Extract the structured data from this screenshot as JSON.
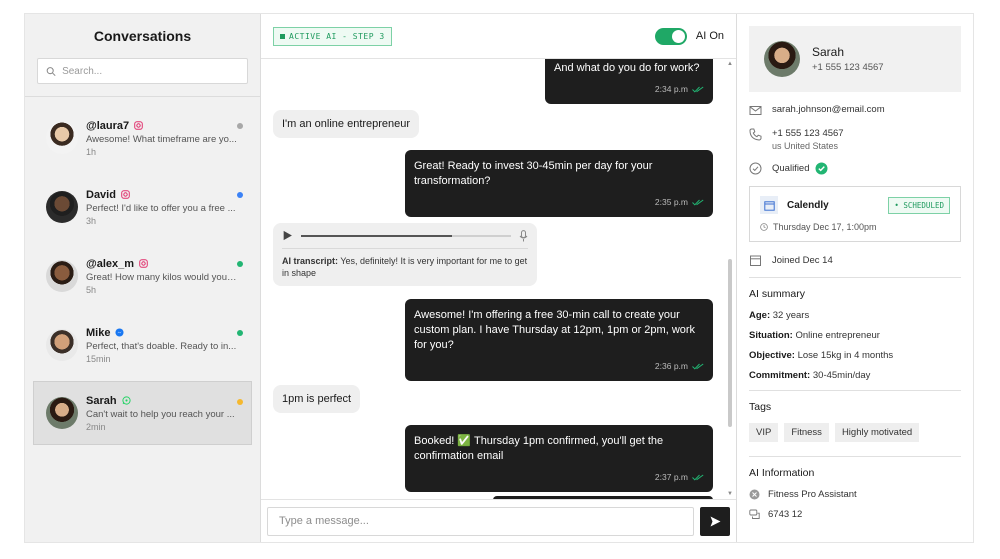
{
  "sidebar": {
    "title": "Conversations",
    "search_placeholder": "Search...",
    "conversations": [
      {
        "name": "@laura7",
        "message": "Awesome! What timeframe are yo...",
        "time": "1h",
        "channel": "instagram",
        "dot": "#a8a8a8"
      },
      {
        "name": "David",
        "message": "Perfect! I'd like to offer you a free ...",
        "time": "3h",
        "channel": "instagram",
        "dot": "#3b82f6"
      },
      {
        "name": "@alex_m",
        "message": "Great! How many kilos would you l...",
        "time": "5h",
        "channel": "instagram",
        "dot": "#22b573"
      },
      {
        "name": "Mike",
        "message": "Perfect, that's doable. Ready to in...",
        "time": "15min",
        "channel": "messenger",
        "dot": "#22b573"
      },
      {
        "name": "Sarah",
        "message": "Can't wait to help you reach your ...",
        "time": "2min",
        "channel": "whatsapp",
        "dot": "#f5b82e"
      }
    ]
  },
  "chat": {
    "status_badge": "ACTIVE AI - STEP 3",
    "ai_toggle_label": "AI On",
    "messages": {
      "m1": {
        "text": "And what do you do for work?",
        "time": "2:34 p.m"
      },
      "m2": {
        "text": "I'm an online entrepreneur"
      },
      "m3": {
        "text": "Great! Ready to invest 30-45min per day for your transformation?",
        "time": "2:35 p.m"
      },
      "m4": {
        "label": "AI transcript:",
        "text": " Yes, definitely! It is very important for me to get in shape"
      },
      "m5": {
        "text": "Awesome! I'm offering a free 30-min call to create your custom plan. I have Thursday at 12pm, 1pm or 2pm, work for you?",
        "time": "2:36 p.m"
      },
      "m6": {
        "text": "1pm is perfect"
      },
      "m7": {
        "text": "Booked! ✅ Thursday 1pm confirmed, you'll get the confirmation email",
        "time": "2:37 p.m"
      }
    },
    "composer_placeholder": "Type a message..."
  },
  "contact": {
    "name": "Sarah",
    "phone": "+1 555 123 4567",
    "email": "sarah.johnson@email.com",
    "phone_detail": "+1 555 123 4567",
    "country": "us United States",
    "status": "Qualified",
    "calendar": {
      "name": "Calendly",
      "badge": "• SCHEDULED",
      "date": "Thursday Dec 17, 1:00pm"
    },
    "joined": "Joined Dec 14",
    "ai_summary": {
      "title": "AI summary",
      "age_label": "Age:",
      "age": " 32 years",
      "situation_label": "Situation:",
      "situation": " Online entrepreneur",
      "objective_label": "Objective:",
      "objective": " Lose 15kg in 4 months",
      "commitment_label": "Commitment:",
      "commitment": " 30-45min/day"
    },
    "tags_title": "Tags",
    "tags": [
      "VIP",
      "Fitness",
      "Highly motivated"
    ],
    "ai_info": {
      "title": "AI Information",
      "assistant": "Fitness Pro Assistant",
      "id": "6743 12"
    }
  },
  "colors": {
    "accent_green": "#1fa866",
    "bubble_dark": "#1e1e1e"
  }
}
